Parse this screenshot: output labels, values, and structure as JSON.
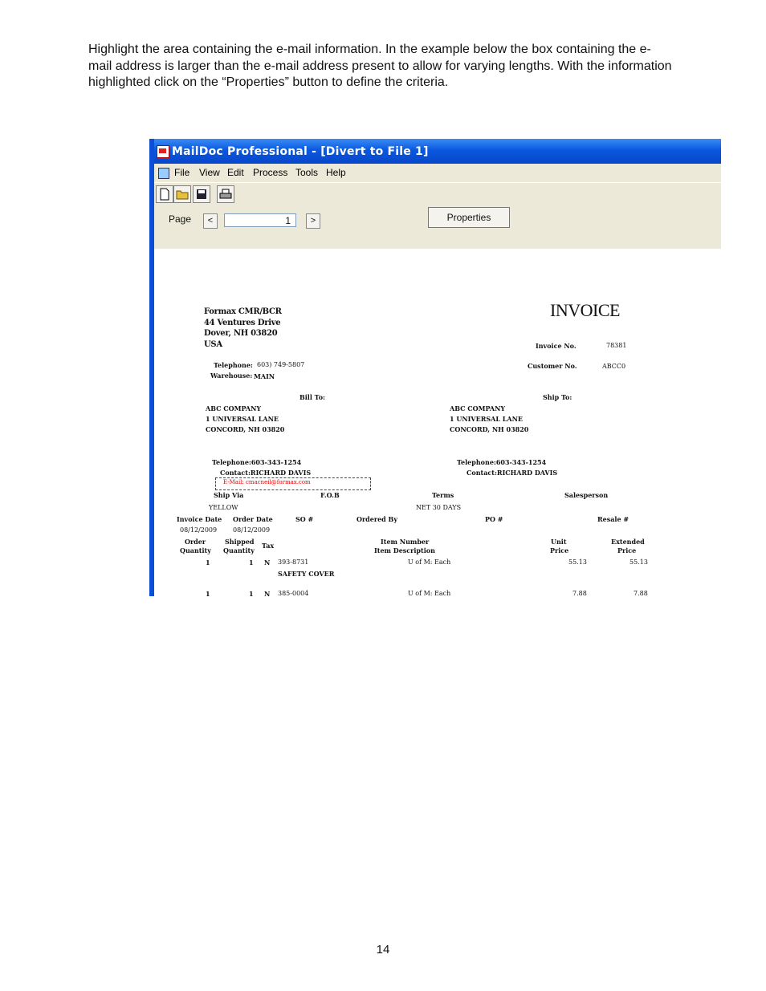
{
  "intro": {
    "line1": "Highlight the area containing the e-mail information.  In the example below the box containing the e-",
    "line2": "mail address is larger than the e-mail address present to allow for varying lengths.  With the information",
    "line3": "highlighted click on the “Properties” button to define the criteria."
  },
  "window": {
    "title": "MailDoc Professional - [Divert to File 1]",
    "menu": [
      "File",
      "View",
      "Edit",
      "Process",
      "Tools",
      "Help"
    ],
    "page_label": "Page",
    "prev_btn": "<",
    "next_btn": ">",
    "page_value": "1",
    "properties_label": "Properties"
  },
  "invoice": {
    "title": "INVOICE",
    "company": [
      "Formax CMR/BCR",
      "44 Ventures Drive",
      "Dover, NH 03820",
      "USA"
    ],
    "invoice_no_label": "Invoice No.",
    "invoice_no": "78381",
    "customer_no_label": "Customer No.",
    "customer_no": "ABCC0",
    "telephone_label": "Telephone:",
    "telephone": "603) 749-5807",
    "warehouse_label": "Warehouse:",
    "warehouse": "MAIN",
    "bill_to_label": "Bill To:",
    "ship_to_label": "Ship To:",
    "bill_to": [
      "ABC COMPANY",
      "1 UNIVERSAL LANE",
      "CONCORD, NH 03820"
    ],
    "ship_to": [
      "ABC COMPANY",
      "1 UNIVERSAL LANE",
      "CONCORD, NH 03820"
    ],
    "bill_phone": "Telephone:603-343-1254",
    "bill_contact": "Contact:RICHARD DAVIS",
    "ship_phone": "Telephone:603-343-1254",
    "ship_contact": "Contact:RICHARD DAVIS",
    "email": "E-Mail: cmacneil@formax.com",
    "headers1": {
      "ship_via": "Ship Via",
      "fob": "F.O.B",
      "terms": "Terms",
      "salesperson": "Salesperson"
    },
    "row1": {
      "ship_via": "YELLOW",
      "terms": "NET 30 DAYS"
    },
    "headers2": {
      "invoice_date": "Invoice Date",
      "order_date": "Order Date",
      "so": "SO #",
      "ordered_by": "Ordered By",
      "po": "PO #",
      "resale": "Resale #"
    },
    "row2": {
      "invoice_date": "08/12/2009",
      "order_date": "08/12/2009"
    },
    "headers3": {
      "order": "Order",
      "order2": "Quantity",
      "shipped": "Shipped",
      "shipped2": "Quantity",
      "tax": "Tax",
      "item": "Item Number",
      "item2": "Item Description",
      "unit": "Unit",
      "unit2": "Price",
      "ext": "Extended",
      "ext2": "Price"
    },
    "items": [
      {
        "order": "1",
        "shipped": "1",
        "tax": "N",
        "item": "393-8731",
        "desc": "SAFETY COVER",
        "uom": "U of M: Each",
        "unit": "55.13",
        "ext": "55.13"
      },
      {
        "order": "1",
        "shipped": "1",
        "tax": "N",
        "item": "385-0004",
        "desc": "",
        "uom": "U of M: Each",
        "unit": "7.88",
        "ext": "7.88"
      }
    ]
  },
  "page_number": "14"
}
